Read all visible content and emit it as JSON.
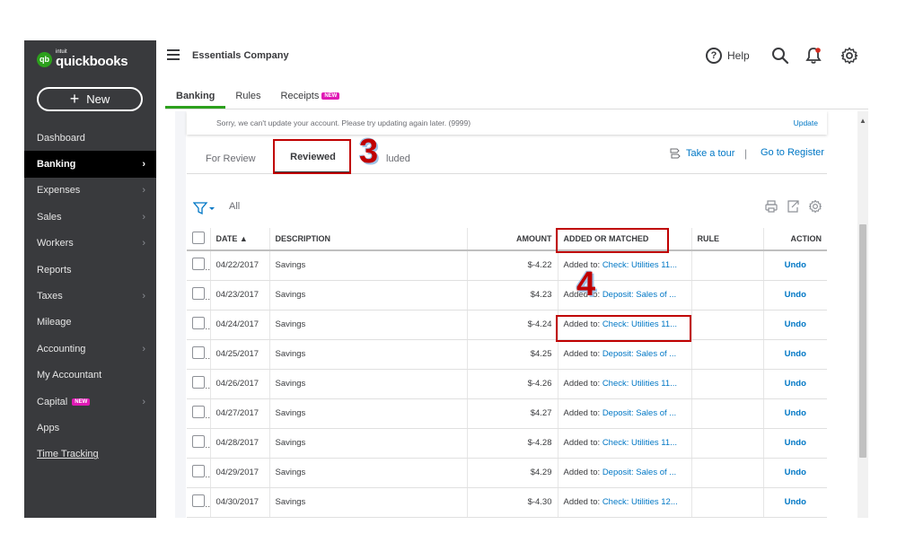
{
  "app": {
    "logo_intuit": "intuit",
    "logo_word": "quickbooks",
    "logo_badge": "qb",
    "new_button": "New",
    "new_plus": "+",
    "company_name": "Essentials Company",
    "help_label": "Help",
    "help_glyph": "?"
  },
  "sidebar": {
    "items": [
      {
        "label": "Dashboard",
        "chevron": ""
      },
      {
        "label": "Banking",
        "chevron": "›"
      },
      {
        "label": "Expenses",
        "chevron": "›"
      },
      {
        "label": "Sales",
        "chevron": "›"
      },
      {
        "label": "Workers",
        "chevron": "›"
      },
      {
        "label": "Reports",
        "chevron": ""
      },
      {
        "label": "Taxes",
        "chevron": "›"
      },
      {
        "label": "Mileage",
        "chevron": ""
      },
      {
        "label": "Accounting",
        "chevron": "›"
      },
      {
        "label": "My Accountant",
        "chevron": ""
      },
      {
        "label": "Capital",
        "chevron": "›",
        "badge": "NEW"
      },
      {
        "label": "Apps",
        "chevron": ""
      },
      {
        "label": "Time Tracking",
        "chevron": ""
      }
    ]
  },
  "subtabs": {
    "banking": "Banking",
    "rules": "Rules",
    "receipts": "Receipts",
    "receipts_badge": "NEW"
  },
  "notice": {
    "text": "Sorry, we can't update your account. Please try updating again later. (9999)",
    "link": "Update"
  },
  "view_tabs": {
    "for_review": "For Review",
    "reviewed": "Reviewed",
    "excluded_partial": "luded",
    "take_tour": "Take a tour",
    "separator": "|",
    "go_register": "Go to Register"
  },
  "filter": {
    "label": "All"
  },
  "table": {
    "headers": {
      "date": "DATE ▲",
      "description": "DESCRIPTION",
      "amount": "AMOUNT",
      "added": "ADDED OR MATCHED",
      "rule": "RULE",
      "action": "ACTION"
    },
    "rows": [
      {
        "date": "04/22/2017",
        "description": "Savings",
        "amount": "$-4.22",
        "added_prefix": "Added to: ",
        "added_link": "Check: Utilities 11...",
        "rule": "",
        "action": "Undo"
      },
      {
        "date": "04/23/2017",
        "description": "Savings",
        "amount": "$4.23",
        "added_prefix": "Added to: ",
        "added_link": "Deposit: Sales of ...",
        "rule": "",
        "action": "Undo"
      },
      {
        "date": "04/24/2017",
        "description": "Savings",
        "amount": "$-4.24",
        "added_prefix": "Added to: ",
        "added_link": "Check: Utilities 11...",
        "rule": "",
        "action": "Undo"
      },
      {
        "date": "04/25/2017",
        "description": "Savings",
        "amount": "$4.25",
        "added_prefix": "Added to: ",
        "added_link": "Deposit: Sales of ...",
        "rule": "",
        "action": "Undo"
      },
      {
        "date": "04/26/2017",
        "description": "Savings",
        "amount": "$-4.26",
        "added_prefix": "Added to: ",
        "added_link": "Check: Utilities 11...",
        "rule": "",
        "action": "Undo"
      },
      {
        "date": "04/27/2017",
        "description": "Savings",
        "amount": "$4.27",
        "added_prefix": "Added to: ",
        "added_link": "Deposit: Sales of ...",
        "rule": "",
        "action": "Undo"
      },
      {
        "date": "04/28/2017",
        "description": "Savings",
        "amount": "$-4.28",
        "added_prefix": "Added to: ",
        "added_link": "Check: Utilities 11...",
        "rule": "",
        "action": "Undo"
      },
      {
        "date": "04/29/2017",
        "description": "Savings",
        "amount": "$4.29",
        "added_prefix": "Added to: ",
        "added_link": "Deposit: Sales of ...",
        "rule": "",
        "action": "Undo"
      },
      {
        "date": "04/30/2017",
        "description": "Savings",
        "amount": "$-4.30",
        "added_prefix": "Added to: ",
        "added_link": "Check: Utilities 12...",
        "rule": "",
        "action": "Undo"
      }
    ]
  },
  "annotations": {
    "step3": "3",
    "step4": "4",
    "step3_color": "#c00000",
    "step4_color": "#c00000"
  },
  "colors": {
    "brand_green": "#2ca01c",
    "link_blue": "#0077c5",
    "sidebar_bg": "#393a3d",
    "badge_pink": "#e01ab5",
    "annotation_red": "#c00000"
  },
  "icons": {
    "hamburger": "menu-icon",
    "search": "search-icon",
    "bell": "bell-icon",
    "gear": "gear-icon",
    "filter": "filter-icon",
    "print": "print-icon",
    "export": "export-icon",
    "settings": "gear-icon",
    "tour": "tour-icon"
  }
}
